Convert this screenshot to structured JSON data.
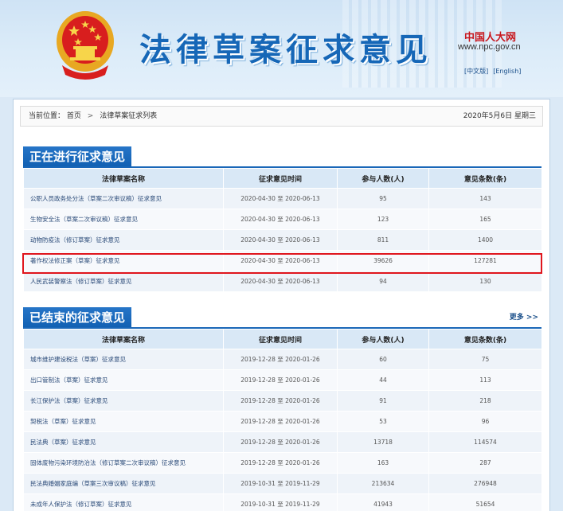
{
  "header": {
    "title": "法律草案征求意见",
    "npc_logo_text": "中国人大网",
    "npc_url": "www.npc.gov.cn",
    "lang_zh": "[中文版]",
    "lang_en": "[English]"
  },
  "breadcrumb": {
    "prefix": "当前位置：",
    "home": "首页",
    "separator": ">",
    "current": "法律草案征求列表",
    "date": "2020年5月6日 星期三"
  },
  "ongoing": {
    "heading": "正在进行征求意见",
    "columns": [
      "法律草案名称",
      "征求意见时间",
      "参与人数(人)",
      "意见条数(条)"
    ],
    "rows": [
      {
        "name": "公职人员政务处分法（草案二次审议稿）征求意见",
        "time": "2020-04-30 至 2020-06-13",
        "people": "95",
        "count": "143"
      },
      {
        "name": "生物安全法（草案二次审议稿）征求意见",
        "time": "2020-04-30 至 2020-06-13",
        "people": "123",
        "count": "165"
      },
      {
        "name": "动物防疫法（修订草案）征求意见",
        "time": "2020-04-30 至 2020-06-13",
        "people": "811",
        "count": "1400"
      },
      {
        "name": "著作权法修正案（草案）征求意见",
        "time": "2020-04-30 至 2020-06-13",
        "people": "39626",
        "count": "127281"
      },
      {
        "name": "人民武装警察法（修订草案）征求意见",
        "time": "2020-04-30 至 2020-06-13",
        "people": "94",
        "count": "130"
      }
    ]
  },
  "closed": {
    "heading": "已结束的征求意见",
    "more": "更多 >>",
    "columns": [
      "法律草案名称",
      "征求意见时间",
      "参与人数(人)",
      "意见条数(条)"
    ],
    "rows": [
      {
        "name": "城市维护建设税法（草案）征求意见",
        "time": "2019-12-28 至 2020-01-26",
        "people": "60",
        "count": "75"
      },
      {
        "name": "出口管制法（草案）征求意见",
        "time": "2019-12-28 至 2020-01-26",
        "people": "44",
        "count": "113"
      },
      {
        "name": "长江保护法（草案）征求意见",
        "time": "2019-12-28 至 2020-01-26",
        "people": "91",
        "count": "218"
      },
      {
        "name": "契税法（草案）征求意见",
        "time": "2019-12-28 至 2020-01-26",
        "people": "53",
        "count": "96"
      },
      {
        "name": "民法典（草案）征求意见",
        "time": "2019-12-28 至 2020-01-26",
        "people": "13718",
        "count": "114574"
      },
      {
        "name": "固体废物污染环境防治法（修订草案二次审议稿）征求意见",
        "time": "2019-12-28 至 2020-01-26",
        "people": "163",
        "count": "287"
      },
      {
        "name": "民法典婚姻家庭编（草案三次审议稿）征求意见",
        "time": "2019-10-31 至 2019-11-29",
        "people": "213634",
        "count": "276948"
      },
      {
        "name": "未成年人保护法（修订草案）征求意见",
        "time": "2019-10-31 至 2019-11-29",
        "people": "41943",
        "count": "51654"
      }
    ]
  },
  "colors": {
    "accent": "#1a67b8",
    "highlight": "#e0161d"
  }
}
